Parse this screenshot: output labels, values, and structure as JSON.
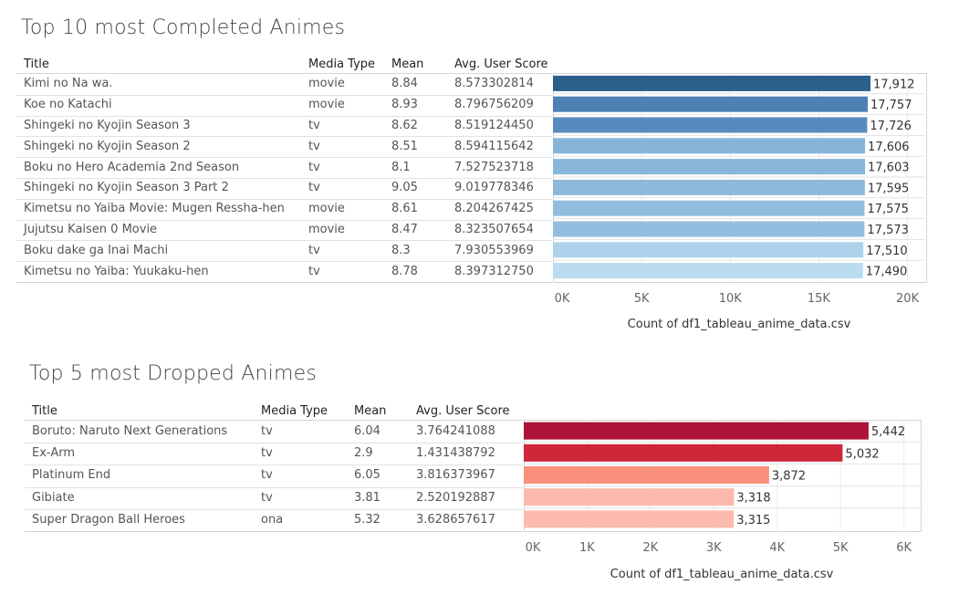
{
  "chart_data": [
    {
      "type": "bar",
      "title": "Top 10 most Completed Animes",
      "columns": [
        "Title",
        "Media Type",
        "Mean",
        "Avg. User Score"
      ],
      "rows": [
        {
          "title": "Kimi no Na wa.",
          "media_type": "movie",
          "mean": "8.84",
          "avg_score": "8.573302814",
          "count": 17912,
          "label": "17,912",
          "color": "#2c5f8a"
        },
        {
          "title": "Koe no Katachi",
          "media_type": "movie",
          "mean": "8.93",
          "avg_score": "8.796756209",
          "count": 17757,
          "label": "17,757",
          "color": "#4d81b3"
        },
        {
          "title": "Shingeki no Kyojin Season 3",
          "media_type": "tv",
          "mean": "8.62",
          "avg_score": "8.519124450",
          "count": 17726,
          "label": "17,726",
          "color": "#578bbd"
        },
        {
          "title": "Shingeki no Kyojin Season 2",
          "media_type": "tv",
          "mean": "8.51",
          "avg_score": "8.594115642",
          "count": 17606,
          "label": "17,606",
          "color": "#87b5da"
        },
        {
          "title": "Boku no Hero Academia 2nd Season",
          "media_type": "tv",
          "mean": "8.1",
          "avg_score": "7.527523718",
          "count": 17603,
          "label": "17,603",
          "color": "#88b6da"
        },
        {
          "title": "Shingeki no Kyojin Season 3 Part 2",
          "media_type": "tv",
          "mean": "9.05",
          "avg_score": "9.019778346",
          "count": 17595,
          "label": "17,595",
          "color": "#8cb9dc"
        },
        {
          "title": "Kimetsu no Yaiba Movie: Mugen Ressha-hen",
          "media_type": "movie",
          "mean": "8.61",
          "avg_score": "8.204267425",
          "count": 17575,
          "label": "17,575",
          "color": "#92bddf"
        },
        {
          "title": "Jujutsu Kaisen 0 Movie",
          "media_type": "movie",
          "mean": "8.47",
          "avg_score": "8.323507654",
          "count": 17573,
          "label": "17,573",
          "color": "#93bee0"
        },
        {
          "title": "Boku dake ga Inai Machi",
          "media_type": "tv",
          "mean": "8.3",
          "avg_score": "7.930553969",
          "count": 17510,
          "label": "17,510",
          "color": "#afd2ec"
        },
        {
          "title": "Kimetsu no Yaiba: Yuukaku-hen",
          "media_type": "tv",
          "mean": "8.78",
          "avg_score": "8.397312750",
          "count": 17490,
          "label": "17,490",
          "color": "#badbf0"
        }
      ],
      "xlim": [
        0,
        21000
      ],
      "xticks": [
        {
          "value": 0,
          "label": "0K"
        },
        {
          "value": 5000,
          "label": "5K"
        },
        {
          "value": 10000,
          "label": "10K"
        },
        {
          "value": 15000,
          "label": "15K"
        },
        {
          "value": 20000,
          "label": "20K"
        }
      ],
      "xlabel": "Count of df1_tableau_anime_data.csv",
      "grid": true
    },
    {
      "type": "bar",
      "title": "Top 5 most Dropped Animes",
      "columns": [
        "Title",
        "Media Type",
        "Mean",
        "Avg. User Score"
      ],
      "rows": [
        {
          "title": "Boruto: Naruto Next Generations",
          "media_type": "tv",
          "mean": "6.04",
          "avg_score": "3.764241088",
          "count": 5442,
          "label": "5,442",
          "color": "#ad1338"
        },
        {
          "title": "Ex-Arm",
          "media_type": "tv",
          "mean": "2.9",
          "avg_score": "1.431438792",
          "count": 5032,
          "label": "5,032",
          "color": "#cf2639"
        },
        {
          "title": "Platinum End",
          "media_type": "tv",
          "mean": "6.05",
          "avg_score": "3.816373967",
          "count": 3872,
          "label": "3,872",
          "color": "#f8907b"
        },
        {
          "title": "Gibiate",
          "media_type": "tv",
          "mean": "3.81",
          "avg_score": "2.520192887",
          "count": 3318,
          "label": "3,318",
          "color": "#fdbaac"
        },
        {
          "title": "Super Dragon Ball Heroes",
          "media_type": "ona",
          "mean": "5.32",
          "avg_score": "3.628657617",
          "count": 3315,
          "label": "3,315",
          "color": "#fdbbae"
        }
      ],
      "xlim": [
        0,
        6250
      ],
      "xticks": [
        {
          "value": 0,
          "label": "0K"
        },
        {
          "value": 1000,
          "label": "1K"
        },
        {
          "value": 2000,
          "label": "2K"
        },
        {
          "value": 3000,
          "label": "3K"
        },
        {
          "value": 4000,
          "label": "4K"
        },
        {
          "value": 5000,
          "label": "5K"
        },
        {
          "value": 6000,
          "label": "6K"
        }
      ],
      "xlabel": "Count of df1_tableau_anime_data.csv",
      "grid": true
    }
  ]
}
